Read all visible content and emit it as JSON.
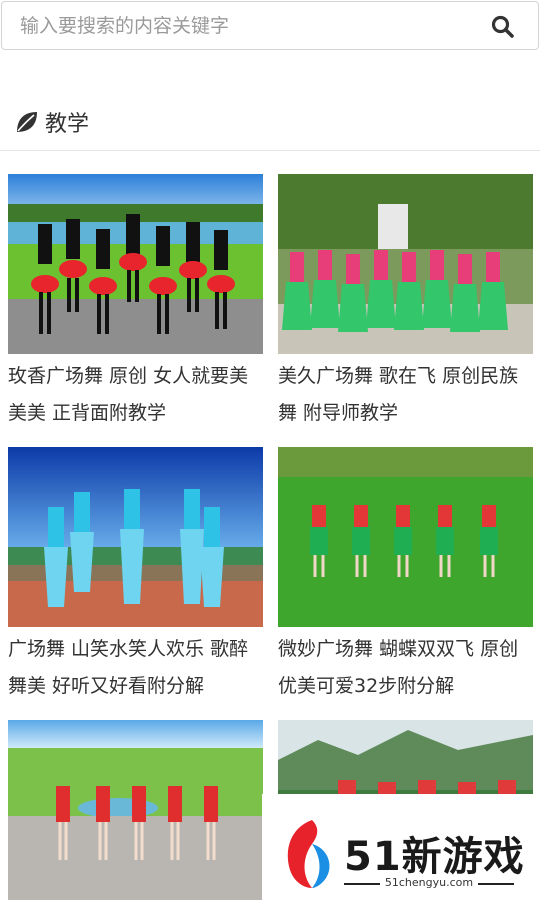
{
  "search": {
    "placeholder": "输入要搜索的内容关键字",
    "icon": "search-icon"
  },
  "section": {
    "title": "教学",
    "icon": "leaf-icon"
  },
  "videos": [
    {
      "title": "玫香广场舞 原创 女人就要美美美 正背面附教学"
    },
    {
      "title": "美久广场舞 歌在飞 原创民族舞 附导师教学"
    },
    {
      "title": "广场舞 山笑水笑人欢乐 歌醉舞美 好听又好看附分解"
    },
    {
      "title": "微妙广场舞 蝴蝶双双飞 原创优美可爱32步附分解"
    },
    {
      "title": ""
    },
    {
      "title": ""
    }
  ],
  "watermark": {
    "brand": "51新游戏",
    "url": "51chengyu.com"
  }
}
